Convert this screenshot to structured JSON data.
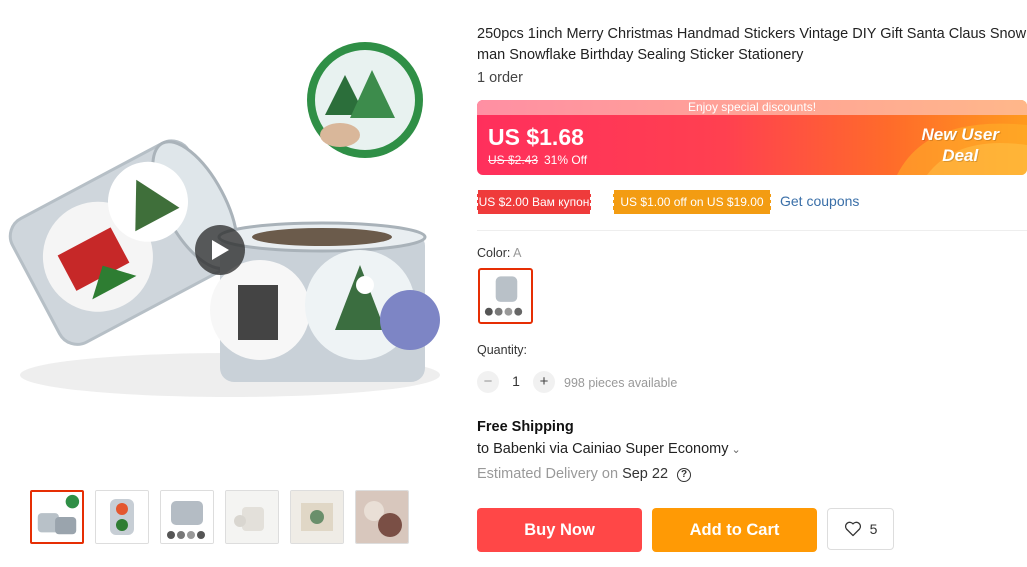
{
  "product": {
    "title": "250pcs 1inch Merry Christmas Handmad Stickers Vintage DIY Gift Santa Claus Snow man Snowflake Birthday Sealing Sticker Stationery",
    "orders": "1 order"
  },
  "gallery": {
    "thumbnails": [
      "thumb-1",
      "thumb-2",
      "thumb-3",
      "thumb-4",
      "thumb-5",
      "thumb-6"
    ],
    "active_index": 0
  },
  "price_banner": {
    "top_text": "Enjoy special discounts!",
    "price": "US $1.68",
    "old_price": "US $2.43",
    "discount": "31% Off",
    "promo_line1": "New User",
    "promo_line2": "Deal"
  },
  "coupons": {
    "coupon1": "US $2.00 Вам купон",
    "coupon2": "US $1.00 off on US $19.00",
    "get_coupons": "Get coupons"
  },
  "options": {
    "color_label": "Color:",
    "color_value": "A"
  },
  "quantity": {
    "label": "Quantity:",
    "minus": "−",
    "plus": "+",
    "value": "1",
    "available": "998 pieces available"
  },
  "shipping": {
    "title": "Free Shipping",
    "route": "to Babenki via Cainiao Super Economy",
    "chevron": "⌄",
    "est_prefix": "Estimated Delivery on",
    "est_date": "Sep 22",
    "help": "?"
  },
  "actions": {
    "buy_now": "Buy Now",
    "add_to_cart": "Add to Cart",
    "wishlist_count": "5"
  },
  "colors": {
    "accent_red": "#ff4747",
    "accent_orange": "#ff9a05",
    "link_blue": "#3a6fa8"
  }
}
